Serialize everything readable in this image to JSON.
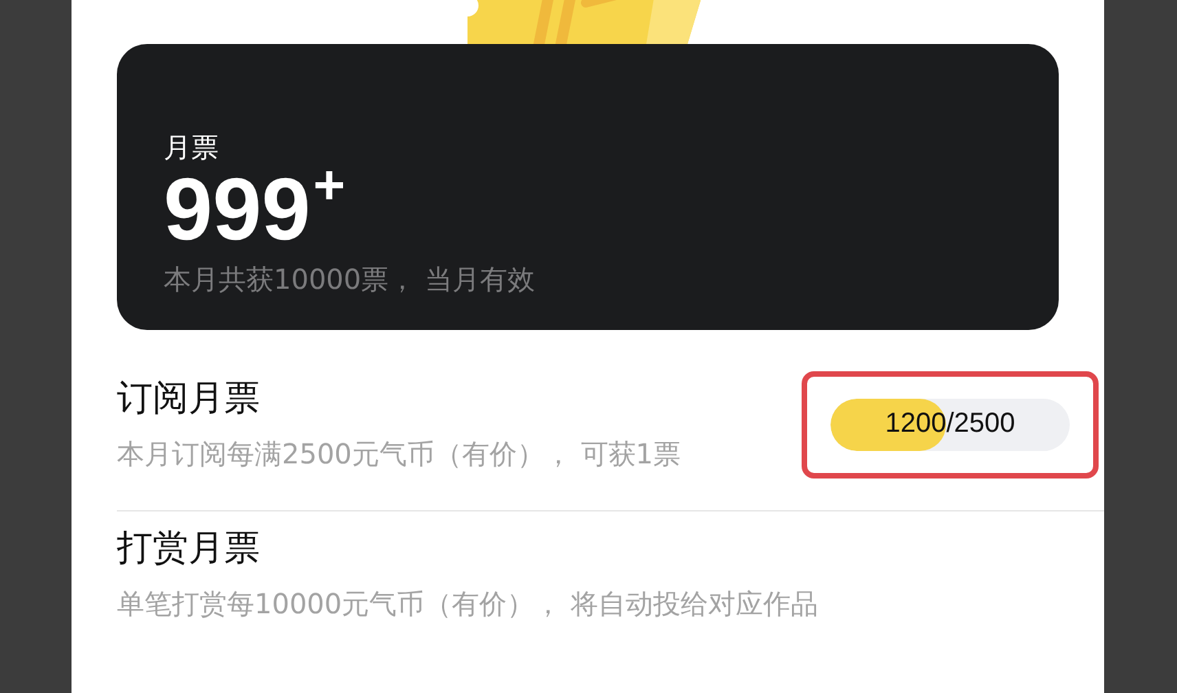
{
  "summary_card": {
    "label": "月票",
    "count": "999",
    "count_suffix": "+",
    "note": "本月共获10000票， 当月有效"
  },
  "sections": [
    {
      "kind": "progress",
      "title": "订阅月票",
      "description": "本月订阅每满2500元气币（有价）， 可获1票",
      "progress": {
        "reading": "1200/2500",
        "level": 0.48,
        "highlighted": true
      }
    },
    {
      "kind": "plain",
      "title": "打赏月票",
      "description": "单笔打赏每10000元气币（有价）， 将自动投给对应作品"
    }
  ]
}
